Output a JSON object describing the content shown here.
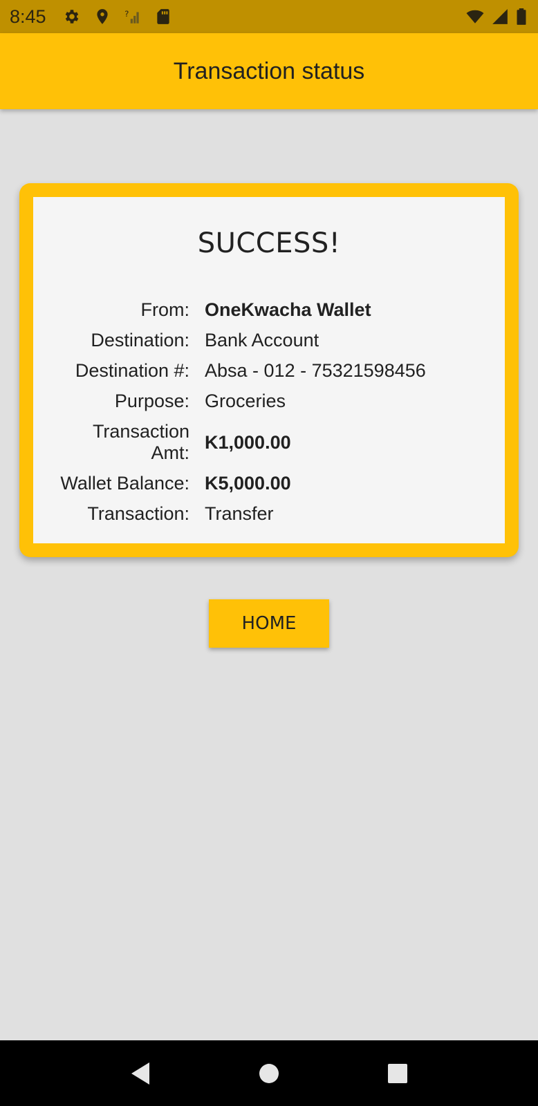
{
  "status_bar": {
    "time": "8:45",
    "icons_left": [
      "gear-icon",
      "location-pin-icon",
      "no-signal-icon",
      "sd-card-icon"
    ],
    "icons_right": [
      "wifi-icon",
      "cell-signal-icon",
      "battery-icon"
    ]
  },
  "app_bar": {
    "title": "Transaction status"
  },
  "card": {
    "heading": "SUCCESS!",
    "rows": [
      {
        "label": "From:",
        "value": "OneKwacha Wallet",
        "bold": true
      },
      {
        "label": "Destination:",
        "value": "Bank Account",
        "bold": false
      },
      {
        "label": "Destination #:",
        "value": "Absa - 012 - 75321598456",
        "bold": false
      },
      {
        "label": "Purpose:",
        "value": "Groceries",
        "bold": false
      },
      {
        "label": "Transaction Amt:",
        "value": "K1,000.00",
        "bold": true
      },
      {
        "label": "Wallet Balance:",
        "value": "K5,000.00",
        "bold": true
      },
      {
        "label": "Transaction:",
        "value": "Transfer",
        "bold": false
      }
    ]
  },
  "home_button": {
    "label": "HOME"
  },
  "nav_bar": {
    "buttons": [
      "back-icon",
      "home-circle-icon",
      "recents-square-icon"
    ]
  },
  "colors": {
    "status_bar": "#bf9000",
    "accent": "#ffc107",
    "background": "#e0e0e0",
    "card_inner": "#f5f5f5"
  }
}
